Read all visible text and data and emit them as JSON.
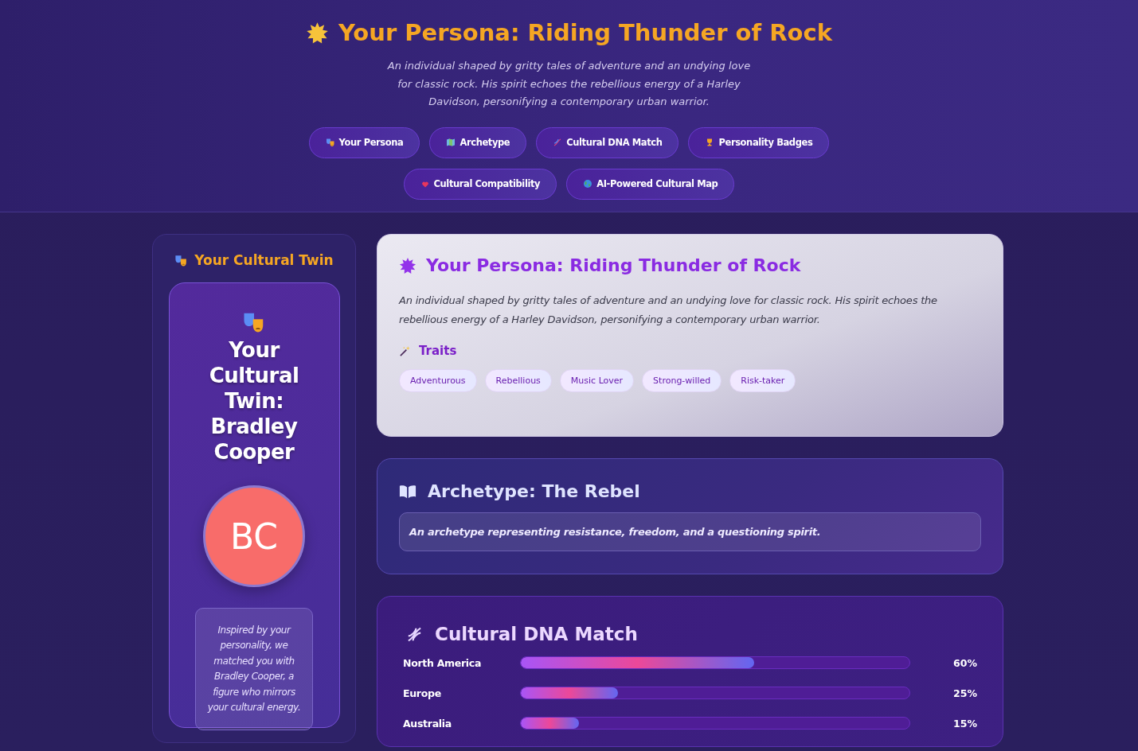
{
  "hero": {
    "title": "Your Persona: Riding Thunder of Rock",
    "subtitle": "An individual shaped by gritty tales of adventure and an undying love for classic rock. His spirit echoes the rebellious energy of a Harley Davidson, personifying a contemporary urban warrior."
  },
  "nav": [
    {
      "label": "Your Persona"
    },
    {
      "label": "Archetype"
    },
    {
      "label": "Cultural DNA Match"
    },
    {
      "label": "Personality Badges"
    },
    {
      "label": "Cultural Compatibility"
    },
    {
      "label": "AI-Powered Cultural Map"
    }
  ],
  "twin": {
    "heading": "Your Cultural Twin",
    "name_title": "Your Cultural Twin: Bradley Cooper",
    "initials": "BC",
    "note": "Inspired by your personality, we matched you with Bradley Cooper, a figure who mirrors your cultural energy."
  },
  "persona": {
    "title": "Your Persona: Riding Thunder of Rock",
    "description": "An individual shaped by gritty tales of adventure and an undying love for classic rock. His spirit echoes the rebellious energy of a Harley Davidson, personifying a contemporary urban warrior.",
    "traits_heading": "Traits",
    "traits": [
      "Adventurous",
      "Rebellious",
      "Music Lover",
      "Strong-willed",
      "Risk-taker"
    ]
  },
  "archetype": {
    "title": "Archetype: The Rebel",
    "description": "An archetype representing resistance, freedom, and a questioning spirit."
  },
  "dna": {
    "title": "Cultural DNA Match",
    "regions": [
      {
        "name": "North America",
        "level": 0.6,
        "reading": "60%"
      },
      {
        "name": "Europe",
        "level": 0.25,
        "reading": "25%"
      },
      {
        "name": "Australia",
        "level": 0.15,
        "reading": "15%"
      }
    ]
  }
}
